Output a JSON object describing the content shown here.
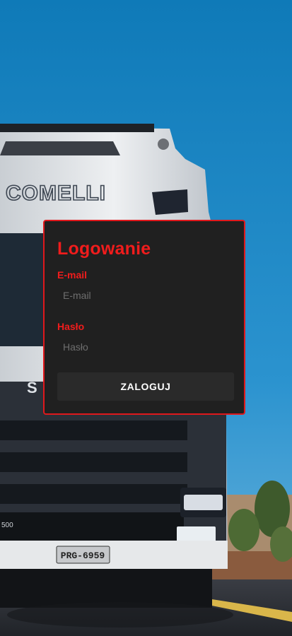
{
  "colors": {
    "accent": "#e0181c",
    "card_background": "#202020",
    "sky": "#1c7fc0",
    "button_background": "#2a2a2a"
  },
  "background": {
    "truck_brand": "COMELLI",
    "license_plate": "PRG-6959",
    "grille_badge": "S",
    "model_badge": "500"
  },
  "login": {
    "title": "Logowanie",
    "email_label": "E-mail",
    "email_placeholder": "E-mail",
    "email_value": "",
    "password_label": "Hasło",
    "password_placeholder": "Hasło",
    "password_value": "",
    "submit_label": "ZALOGUJ"
  }
}
